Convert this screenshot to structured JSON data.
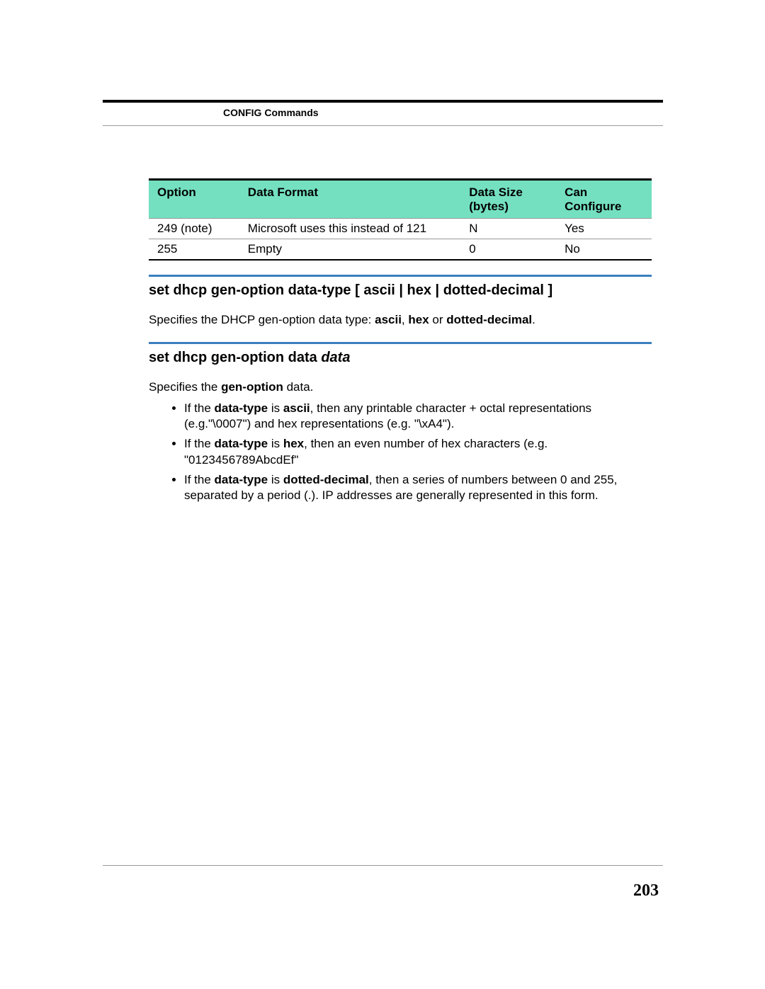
{
  "header": {
    "title": "CONFIG Commands"
  },
  "table": {
    "headers": {
      "option": "Option",
      "format": "Data Format",
      "size": "Data Size (bytes)",
      "configure": "Can Configure"
    },
    "rows": [
      {
        "option": "249 (note)",
        "format": "Microsoft uses this instead of 121",
        "size": "N",
        "configure": "Yes"
      },
      {
        "option": "255",
        "format": "Empty",
        "size": "0",
        "configure": "No"
      }
    ]
  },
  "section1": {
    "title": "set dhcp gen-option data-type [ ascii | hex | dotted-decimal ]",
    "body_pre": "Specifies the DHCP gen-option data type: ",
    "b1": "ascii",
    "sep1": ", ",
    "b2": "hex",
    "sep2": " or ",
    "b3": "dotted-decimal",
    "post": "."
  },
  "section2": {
    "title_plain": "set dhcp gen-option data ",
    "title_ital": "data",
    "intro_pre": "Specifies the ",
    "intro_b": "gen-option",
    "intro_post": " data.",
    "bullets": [
      {
        "pre": "If the ",
        "b1": "data-type",
        "mid1": " is ",
        "b2": "ascii",
        "post": ", then any printable character + octal representations (e.g.\"\\0007\") and hex representations (e.g. \"\\xA4\")."
      },
      {
        "pre": "If the ",
        "b1": "data-type",
        "mid1": " is ",
        "b2": "hex",
        "post": ", then an even number of hex characters (e.g. \"0123456789AbcdEf\""
      },
      {
        "pre": "If the ",
        "b1": "data-type",
        "mid1": " is ",
        "b2": "dotted-decimal",
        "post": ", then a series of numbers between 0 and 255, separated by a period (.). IP addresses are generally represented in this form."
      }
    ]
  },
  "page_number": "203"
}
